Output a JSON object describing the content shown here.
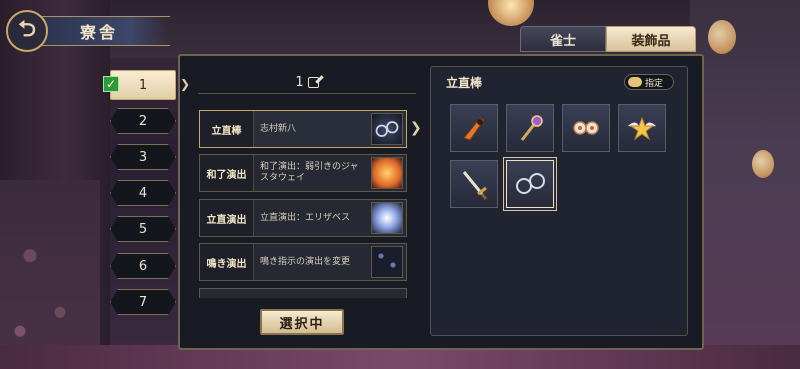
{
  "header": {
    "title": "寮舎",
    "back_icon": "back-arrow-icon"
  },
  "tabs": [
    {
      "label": "雀士",
      "active": false
    },
    {
      "label": "装飾品",
      "active": true
    }
  ],
  "slots": [
    {
      "label": "1",
      "active": true
    },
    {
      "label": "2"
    },
    {
      "label": "3"
    },
    {
      "label": "4"
    },
    {
      "label": "5"
    },
    {
      "label": "6"
    },
    {
      "label": "7"
    }
  ],
  "loadout": {
    "name": "1",
    "rows": [
      {
        "label": "立直棒",
        "value": "志村新八",
        "icon": "glasses-icon",
        "selected": true
      },
      {
        "label": "和了演出",
        "value": "和了演出：弱引きのジャスタウェイ",
        "icon": "explosion-icon"
      },
      {
        "label": "立直演出",
        "value": "立直演出：エリザベス",
        "icon": "sparkle-icon"
      },
      {
        "label": "鳴き演出",
        "value": "鳴き指示の演出を変更",
        "icon": "stars-icon"
      }
    ],
    "select_button": "選択中"
  },
  "inventory": {
    "title": "立直棒",
    "toggle_label": "指定",
    "items": [
      {
        "icon": "orange-blade-icon"
      },
      {
        "icon": "purple-staff-icon"
      },
      {
        "icon": "double-orb-icon"
      },
      {
        "icon": "winged-star-icon"
      },
      {
        "icon": "golden-sword-icon"
      },
      {
        "icon": "glasses-icon",
        "selected": true
      }
    ]
  },
  "colors": {
    "accent": "#c7a56a",
    "panel": "#191b24",
    "tab_active": "#f6ead0"
  }
}
